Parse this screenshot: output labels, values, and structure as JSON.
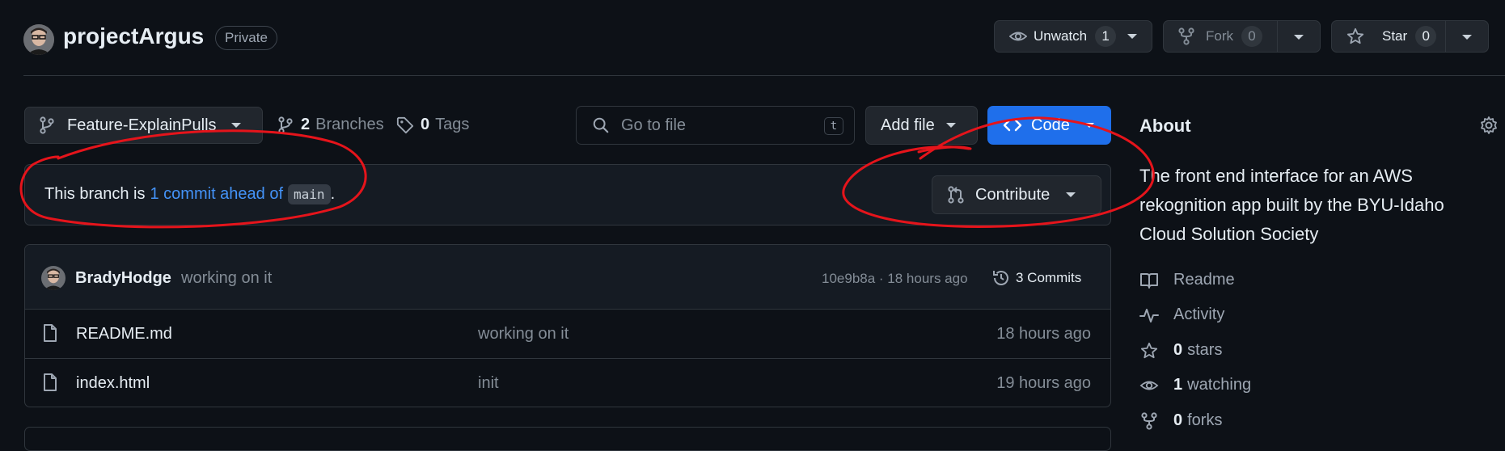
{
  "repo": {
    "name": "projectArgus",
    "visibility": "Private"
  },
  "header_actions": {
    "unwatch_label": "Unwatch",
    "unwatch_count": "1",
    "fork_label": "Fork",
    "fork_count": "0",
    "star_label": "Star",
    "star_count": "0"
  },
  "toolbar": {
    "branch_name": "Feature-ExplainPulls",
    "branches_count": "2",
    "branches_label": "Branches",
    "tags_count": "0",
    "tags_label": "Tags",
    "search_placeholder": "Go to file",
    "search_shortcut": "t",
    "add_file_label": "Add file",
    "code_label": "Code"
  },
  "branch_banner": {
    "prefix": "This branch is",
    "ahead_link": "1 commit ahead of",
    "base_branch": "main",
    "suffix": ".",
    "contribute_label": "Contribute"
  },
  "latest_commit": {
    "author": "BradyHodge",
    "message": "working on it",
    "hash_time": "10e9b8a · 18 hours ago",
    "commits_label": "3 Commits"
  },
  "files": [
    {
      "name": "README.md",
      "message": "working on it",
      "time": "18 hours ago"
    },
    {
      "name": "index.html",
      "message": "init",
      "time": "19 hours ago"
    }
  ],
  "about": {
    "heading": "About",
    "description": "The front end interface for an AWS rekognition app built by the BYU-Idaho Cloud Solution Society",
    "readme": "Readme",
    "activity": "Activity",
    "stars_count": "0",
    "stars_label": "stars",
    "watching_count": "1",
    "watching_label": "watching",
    "forks_count": "0",
    "forks_label": "forks"
  },
  "colors": {
    "background": "#0d1117",
    "primary_button": "#1f6feb",
    "link": "#4493f8",
    "annotation": "#e5141b"
  }
}
